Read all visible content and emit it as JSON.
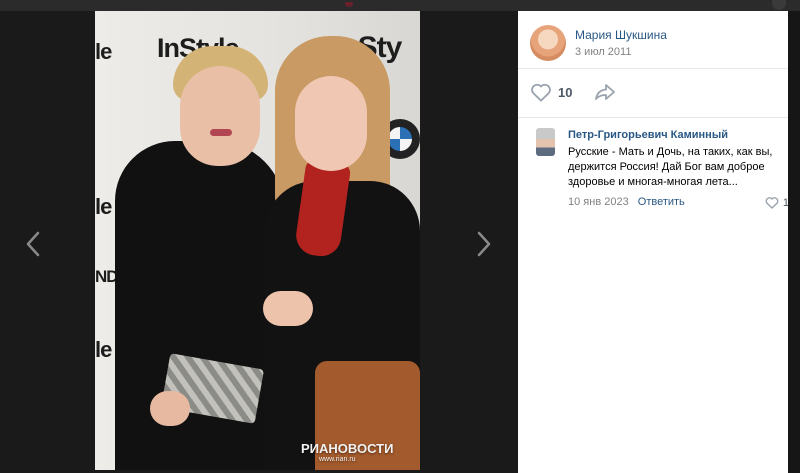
{
  "post": {
    "author_name": "Мария Шукшина",
    "date": "3 июл 2011",
    "likes": "10"
  },
  "photo": {
    "logo_text_1": "InStyle",
    "logo_text_2": "InSty",
    "left_fragment_1": "le",
    "left_fragment_2": "le",
    "left_fragment_3": "NDI",
    "left_fragment_4": "le",
    "watermark": "РИАНОВОСТИ",
    "watermark_url": "www.rian.ru"
  },
  "comment": {
    "author": "Петр-Григорьевич Каминный",
    "text": "Русские - Мать и Дочь, на таких, как вы, держится Россия! Дай Бог вам доброе здоровье и многая-многая лета...",
    "date": "10 янв 2023",
    "reply_label": "Ответить",
    "likes": "1"
  },
  "colors": {
    "link": "#2a5885",
    "muted": "#828282",
    "viewer_bg": "#1a1a1a"
  },
  "icons": {
    "prev": "chevron-left-icon",
    "next": "chevron-right-icon",
    "like": "heart-icon",
    "share": "share-arrow-icon"
  }
}
